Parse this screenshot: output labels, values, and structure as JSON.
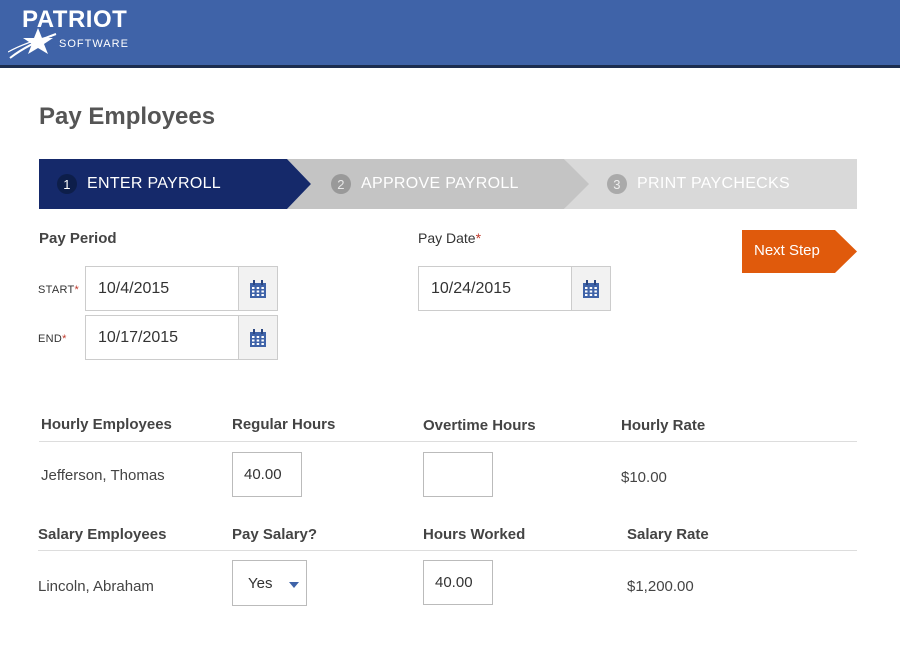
{
  "header": {
    "logo_title": "PATRIOT",
    "logo_subtitle": "SOFTWARE",
    "colors": {
      "header_bg": "#3f63a8",
      "header_border": "#1c2d4f"
    }
  },
  "page_title": "Pay Employees",
  "stepper": {
    "steps": [
      {
        "num": "1",
        "label": "ENTER PAYROLL",
        "state": "active"
      },
      {
        "num": "2",
        "label": "APPROVE PAYROLL",
        "state": "inactive"
      },
      {
        "num": "3",
        "label": "PRINT PAYCHECKS",
        "state": "inactive"
      }
    ],
    "colors": {
      "active": "#15296a",
      "step2": "#c4c4c4",
      "step3": "#d9d9d9"
    }
  },
  "pay_period": {
    "label": "Pay Period",
    "start_label": "START",
    "start_value": "10/4/2015",
    "end_label": "END",
    "end_value": "10/17/2015",
    "required_mark": "*"
  },
  "pay_date": {
    "label": "Pay Date",
    "value": "10/24/2015",
    "required_mark": "*"
  },
  "next_step": {
    "label": "Next Step",
    "color": "#e05a0c"
  },
  "hourly": {
    "headers": [
      "Hourly Employees",
      "Regular Hours",
      "Overtime Hours",
      "Hourly Rate"
    ],
    "rows": [
      {
        "name": "Jefferson, Thomas",
        "regular_hours": "40.00",
        "overtime_hours": "",
        "rate": "$10.00"
      }
    ]
  },
  "salary": {
    "headers": [
      "Salary Employees",
      "Pay Salary?",
      "Hours Worked",
      "Salary Rate"
    ],
    "rows": [
      {
        "name": "Lincoln, Abraham",
        "pay_salary": "Yes",
        "hours_worked": "40.00",
        "rate": "$1,200.00"
      }
    ]
  },
  "icons": {
    "calendar": "calendar-icon",
    "dropdown": "chevron-down-icon",
    "logo_star": "star-swoosh-icon"
  }
}
